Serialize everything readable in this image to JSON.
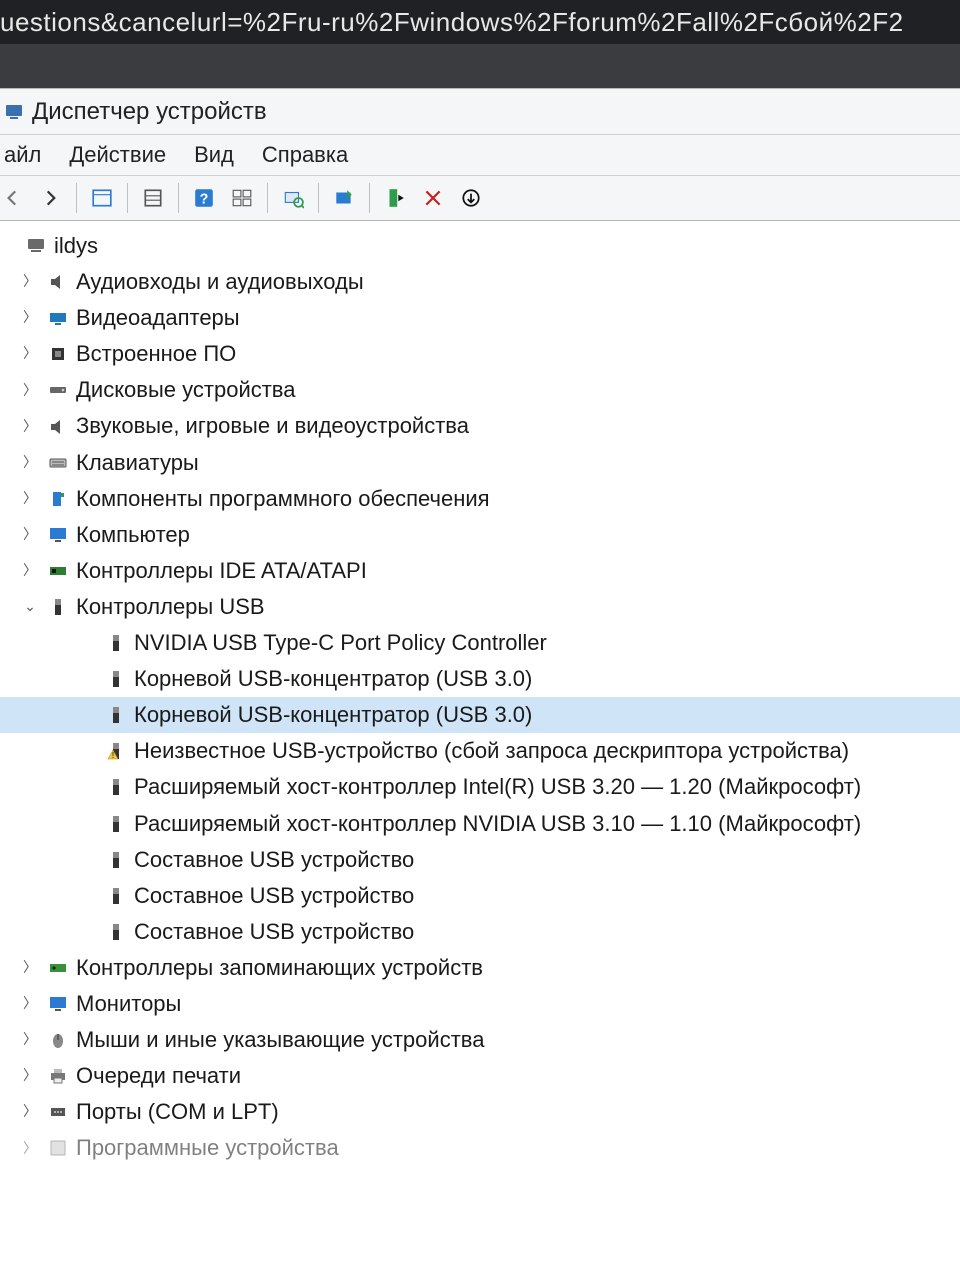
{
  "urlFragment": "uestions&cancelurl=%2Fru-ru%2Fwindows%2Fforum%2Fall%2Fсбой%2F2",
  "window": {
    "title": "Диспетчер устройств"
  },
  "menu": {
    "file": "айл",
    "action": "Действие",
    "view": "Вид",
    "help": "Справка"
  },
  "tree": {
    "root": "ildys",
    "cats": {
      "audio": "Аудиовходы и аудиовыходы",
      "video": "Видеоадаптеры",
      "firmware": "Встроенное ПО",
      "disk": "Дисковые устройства",
      "sound": "Звуковые, игровые и видеоустройства",
      "keyboard": "Клавиатуры",
      "swcomp": "Компоненты программного обеспечения",
      "computer": "Компьютер",
      "ide": "Контроллеры IDE ATA/ATAPI",
      "usb": "Контроллеры USB",
      "storage": "Контроллеры запоминающих устройств",
      "monitor": "Мониторы",
      "mouse": "Мыши и иные указывающие устройства",
      "print": "Очереди печати",
      "ports": "Порты (COM и LPT)",
      "swdev": "Программные устройства"
    },
    "usbChildren": {
      "c0": "NVIDIA USB Type-C Port Policy Controller",
      "c1": "Корневой USB-концентратор (USB 3.0)",
      "c2": "Корневой USB-концентратор (USB 3.0)",
      "c3": "Неизвестное USB-устройство (сбой запроса дескриптора устройства)",
      "c4": "Расширяемый хост-контроллер Intel(R) USB 3.20 — 1.20 (Майкрософт)",
      "c5": "Расширяемый хост-контроллер NVIDIA USB 3.10 — 1.10 (Майкрософт)",
      "c6": "Составное USB устройство",
      "c7": "Составное USB устройство",
      "c8": "Составное USB устройство"
    }
  }
}
